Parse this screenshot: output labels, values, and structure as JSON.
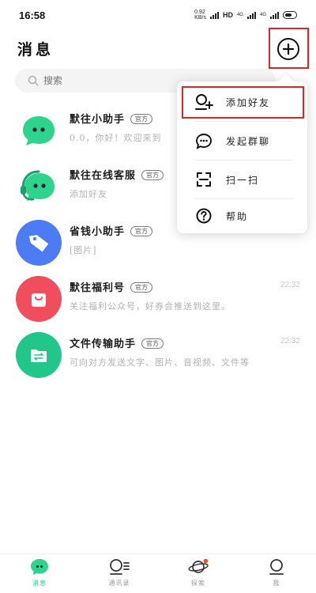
{
  "status_bar": {
    "time": "16:58",
    "speed": "0.92\nKB/s",
    "network": "HD",
    "signal1": "4G",
    "signal2": "4G"
  },
  "header": {
    "title": "消息"
  },
  "search": {
    "placeholder": "搜索"
  },
  "chats": [
    {
      "name": "默往小助手",
      "badge": "官方",
      "preview": "0.0，你好！欢迎来到",
      "time": "",
      "avatar_color": "#2ed48c",
      "avatar_icon": "chat-bubble-eyes-icon"
    },
    {
      "name": "默往在线客服",
      "badge": "官方",
      "preview": "添加好友",
      "time": "",
      "avatar_color": "#2ed48c",
      "avatar_icon": "headset-bubble-icon"
    },
    {
      "name": "省钱小助手",
      "badge": "官方",
      "preview": "[图片]",
      "time": "",
      "avatar_color": "#4d7bf3",
      "avatar_icon": "price-tag-icon"
    },
    {
      "name": "默往福利号",
      "badge": "官方",
      "preview": "关注福利公众号，好券会推送到这里。",
      "time": "22:32",
      "avatar_color": "#f04d5d",
      "avatar_icon": "shopping-bag-icon"
    },
    {
      "name": "文件传输助手",
      "badge": "官方",
      "preview": "可向对方发送文字、图片、音视频、文件等",
      "time": "22:32",
      "avatar_color": "#20c68a",
      "avatar_icon": "folder-transfer-icon"
    }
  ],
  "popup_menu": {
    "items": [
      {
        "label": "添加好友",
        "icon": "add-user-icon"
      },
      {
        "label": "发起群聊",
        "icon": "group-chat-icon"
      },
      {
        "label": "扫一扫",
        "icon": "scan-icon"
      },
      {
        "label": "帮助",
        "icon": "help-icon"
      }
    ]
  },
  "bottom_nav": {
    "items": [
      {
        "label": "消息",
        "icon": "message-icon",
        "active": true
      },
      {
        "label": "通讯录",
        "icon": "contacts-icon",
        "active": false
      },
      {
        "label": "探索",
        "icon": "planet-icon",
        "active": false
      },
      {
        "label": "我",
        "icon": "profile-icon",
        "active": false
      }
    ]
  },
  "colors": {
    "accent": "#18c98b",
    "highlight_red": "#d62828"
  }
}
